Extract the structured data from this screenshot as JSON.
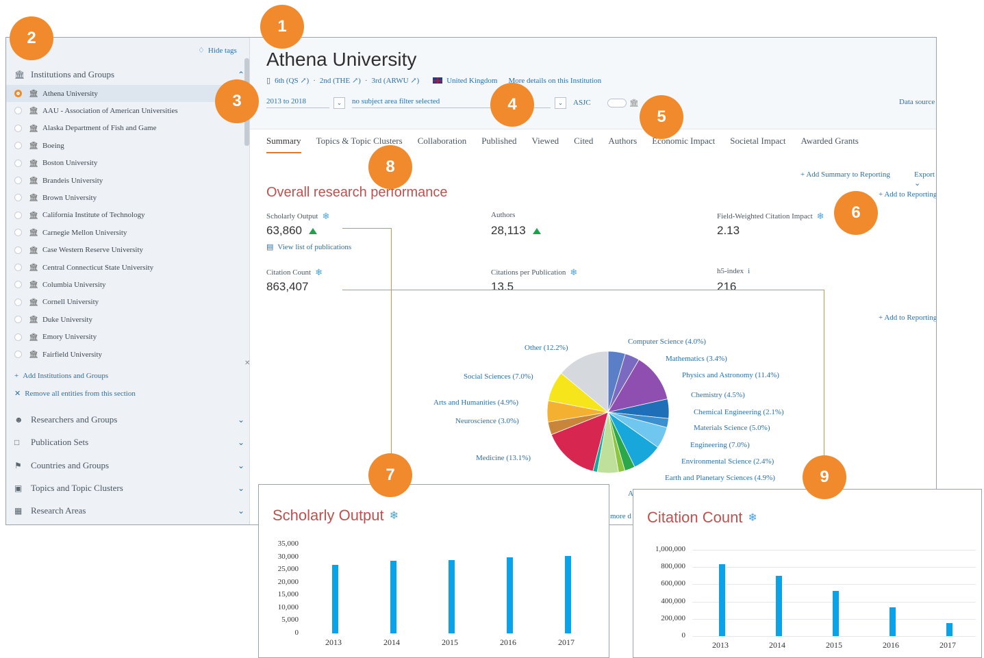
{
  "badges": [
    "1",
    "2",
    "3",
    "4",
    "5",
    "6",
    "7",
    "8",
    "9"
  ],
  "sidebar": {
    "hide_tags": "Hide tags",
    "institutions_header": "Institutions and Groups",
    "institutions": [
      "Athena University",
      "AAU - Association of American Universities",
      "Alaska Department of Fish and Game",
      "Boeing",
      "Boston University",
      "Brandeis University",
      "Brown University",
      "California Institute of Technology",
      "Carnegie Mellon University",
      "Case Western Reserve University",
      "Central Connecticut State University",
      "Columbia University",
      "Cornell University",
      "Duke University",
      "Emory University",
      "Fairfield University"
    ],
    "selected_index": 0,
    "add_link": "Add Institutions and Groups",
    "remove_link": "Remove all entities from this section",
    "sections": [
      "Researchers and Groups",
      "Publication Sets",
      "Countries and Groups",
      "Topics and Topic Clusters",
      "Research Areas"
    ]
  },
  "header": {
    "title": "Athena University",
    "rank_qs": "6th (QS ↗)",
    "rank_the": "2nd (THE ↗)",
    "rank_arwu": "3rd (ARWU ↗)",
    "country": "United Kingdom",
    "more_details": "More details on this Institution",
    "year_range": "2013 to 2018",
    "subject_filter": "no subject area filter selected",
    "asjc": "ASJC",
    "data_source": "Data source"
  },
  "tabs": [
    "Summary",
    "Topics & Topic Clusters",
    "Collaboration",
    "Published",
    "Viewed",
    "Cited",
    "Authors",
    "Economic Impact",
    "Societal Impact",
    "Awarded Grants"
  ],
  "active_tab": 0,
  "overview": {
    "section_title": "Overall research performance",
    "add_summary": "+ Add Summary to Reporting",
    "export": "Export",
    "add_to_reporting": "+ Add to Reporting",
    "view_list": "View list of publications",
    "metrics": [
      {
        "label": "Scholarly Output",
        "value": "63,860"
      },
      {
        "label": "Authors",
        "value": "28,113"
      },
      {
        "label": "Field-Weighted Citation Impact",
        "value": "2.13"
      },
      {
        "label": "Citation Count",
        "value": "863,407"
      },
      {
        "label": "Citations per Publication",
        "value": "13.5"
      },
      {
        "label": "h5-index",
        "value": "216"
      }
    ]
  },
  "pie_labels": [
    "Computer Science (4.0%)",
    "Mathematics (3.4%)",
    "Physics and Astronomy (11.4%)",
    "Chemistry (4.5%)",
    "Chemical Engineering (2.1%)",
    "Materials Science (5.0%)",
    "Engineering (7.0%)",
    "Environmental Science (2.4%)",
    "Earth and Planetary Sciences (4.9%)",
    "Medicine (13.1%)",
    "Neuroscience (3.0%)",
    "Arts and Humanities (4.9%)",
    "Social Sciences (7.0%)",
    "Other (12.2%)"
  ],
  "pie_fragments": {
    "bottom_a": "A",
    "more": "more d"
  },
  "pie_colors": [
    "#5b7fc7",
    "#7a6bc1",
    "#8f4fb0",
    "#1f6fb8",
    "#3a8fd0",
    "#6fc6ef",
    "#17a7db",
    "#2aa84a",
    "#8cc63f",
    "#bfe09a",
    "#12a89a",
    "#d7264f",
    "#c9863a",
    "#f4b030",
    "#f5e51a",
    "#d5d8dd"
  ],
  "pie_values": [
    4.0,
    3.4,
    11.4,
    4.5,
    2.1,
    5.0,
    7.0,
    2.4,
    1.5,
    4.9,
    1.0,
    13.1,
    3.0,
    4.9,
    7.0,
    12.2
  ],
  "chart_data": [
    {
      "type": "bar",
      "title": "Scholarly Output",
      "categories": [
        "2013",
        "2014",
        "2015",
        "2016",
        "2017"
      ],
      "values": [
        27000,
        28500,
        28700,
        29800,
        30500
      ],
      "ylim": [
        0,
        35000
      ],
      "yticks": [
        "35,000",
        "30,000",
        "25,000",
        "20,000",
        "15,000",
        "10,000",
        "5,000",
        "0"
      ]
    },
    {
      "type": "bar",
      "title": "Citation Count",
      "categories": [
        "2013",
        "2014",
        "2015",
        "2016",
        "2017"
      ],
      "values": [
        830000,
        700000,
        520000,
        335000,
        150000
      ],
      "ylim": [
        0,
        1000000
      ],
      "yticks": [
        "1,000,000",
        "800,000",
        "600,000",
        "400,000",
        "200,000",
        "0"
      ]
    }
  ]
}
